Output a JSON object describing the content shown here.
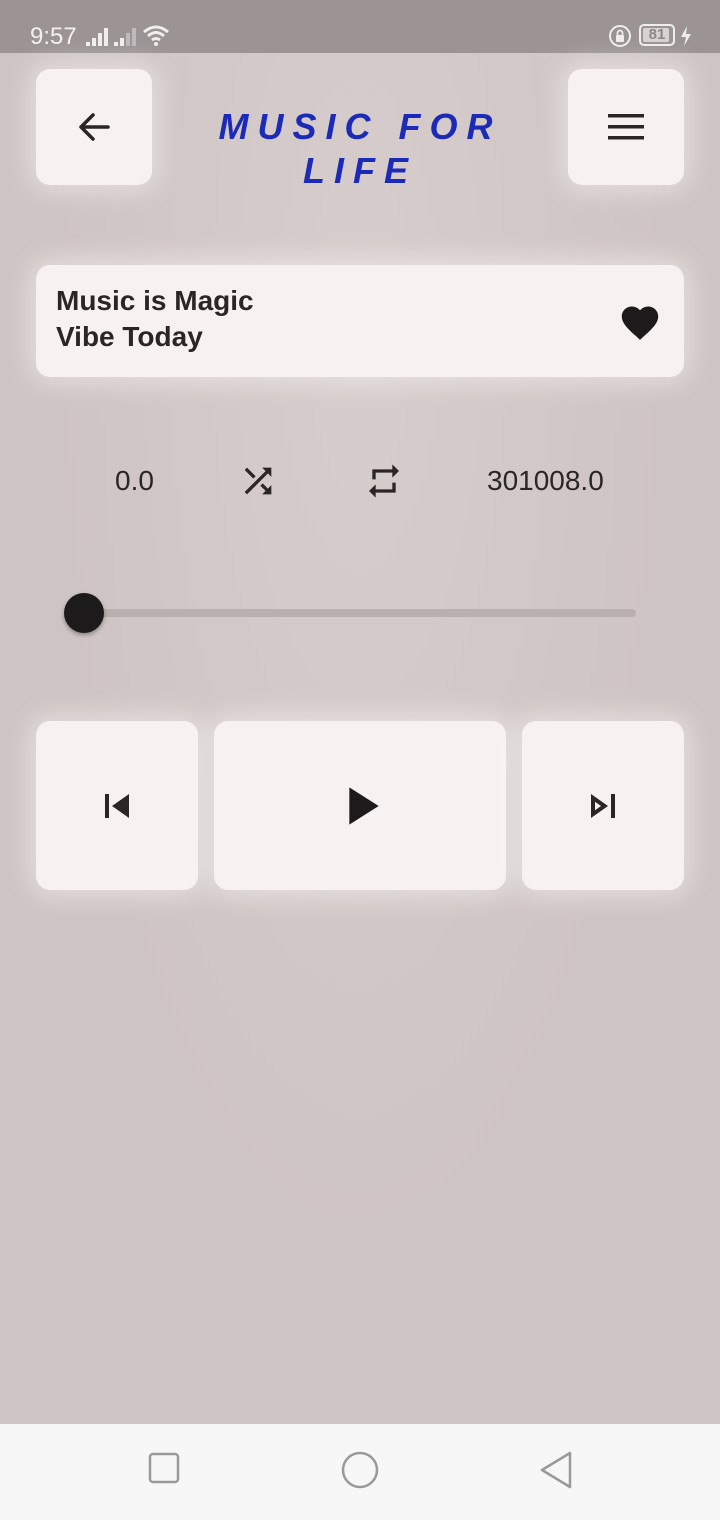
{
  "status_bar": {
    "time": "9:57",
    "battery_level": "81",
    "icons": [
      "signal-icon",
      "signal-icon",
      "wifi-icon",
      "rotation-lock-icon",
      "battery-icon",
      "charging-bolt-icon"
    ]
  },
  "header": {
    "title": "MUSIC FOR LIFE",
    "back_icon": "arrow-left-icon",
    "menu_icon": "hamburger-menu-icon",
    "title_color": "#1b2ab7"
  },
  "song": {
    "title": "Music is Magic",
    "artist": "Vibe Today",
    "favorite_icon": "heart-icon"
  },
  "playback": {
    "current_position": "0.0",
    "duration": "301008.0",
    "progress_fraction": 0.0,
    "shuffle_icon": "shuffle-icon",
    "repeat_icon": "repeat-icon"
  },
  "controls": {
    "previous_icon": "skip-previous-icon",
    "play_icon": "play-icon",
    "next_icon": "skip-next-icon"
  },
  "navbar": {
    "icons": [
      "recent-apps-icon",
      "home-icon",
      "back-icon"
    ]
  },
  "colors": {
    "background": "#cfc4c4",
    "card": "#f8f1f1",
    "accent": "#1b2ab7"
  }
}
